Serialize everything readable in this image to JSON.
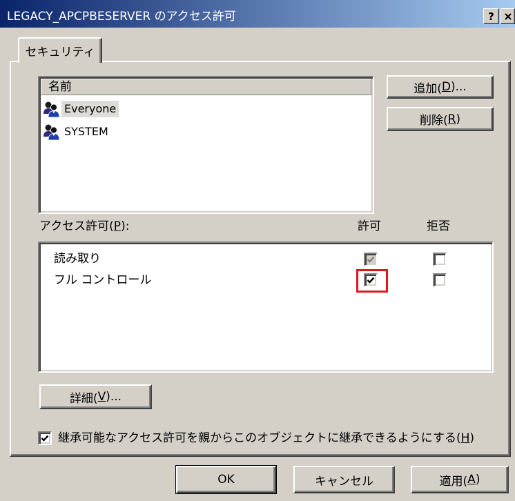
{
  "window": {
    "title": "LEGACY_APCPBESERVER のアクセス許可",
    "help_label": "?"
  },
  "icons": {
    "help": "help-icon",
    "close": "close-icon",
    "group": "group-icon",
    "check": "checkmark-icon"
  },
  "tabs": [
    {
      "label": "セキュリティ",
      "active": true
    }
  ],
  "names_list": {
    "header": "名前",
    "items": [
      {
        "name": "Everyone",
        "icon": "group-icon",
        "selected": true
      },
      {
        "name": "SYSTEM",
        "icon": "group-icon",
        "selected": false
      }
    ]
  },
  "name_buttons": {
    "add_label": "追加(D)...",
    "remove_label": "削除(R)"
  },
  "permissions": {
    "label": "アクセス許可(P):",
    "allow_header": "許可",
    "deny_header": "拒否",
    "rows": [
      {
        "name": "読み取り",
        "allow": true,
        "allow_disabled": true,
        "deny": false,
        "highlighted": false
      },
      {
        "name": "フル コントロール",
        "allow": true,
        "allow_disabled": false,
        "deny": false,
        "highlighted": true
      }
    ]
  },
  "advanced_button": {
    "label": "詳細(V)..."
  },
  "inherit": {
    "label": "継承可能なアクセス許可を親からこのオブジェクトに継承できるようにする(H)",
    "checked": true
  },
  "footer": {
    "ok_label": "OK",
    "cancel_label": "キャンセル",
    "apply_label": "適用(A)"
  },
  "colors": {
    "dialog_bg": "#D4D0C8",
    "title_gradient_start": "#0A246A",
    "title_gradient_end": "#A6CAF0",
    "title_text": "#FFFFFF",
    "annotation": "#E0161E",
    "selection_bg": "#DEDCD7"
  }
}
